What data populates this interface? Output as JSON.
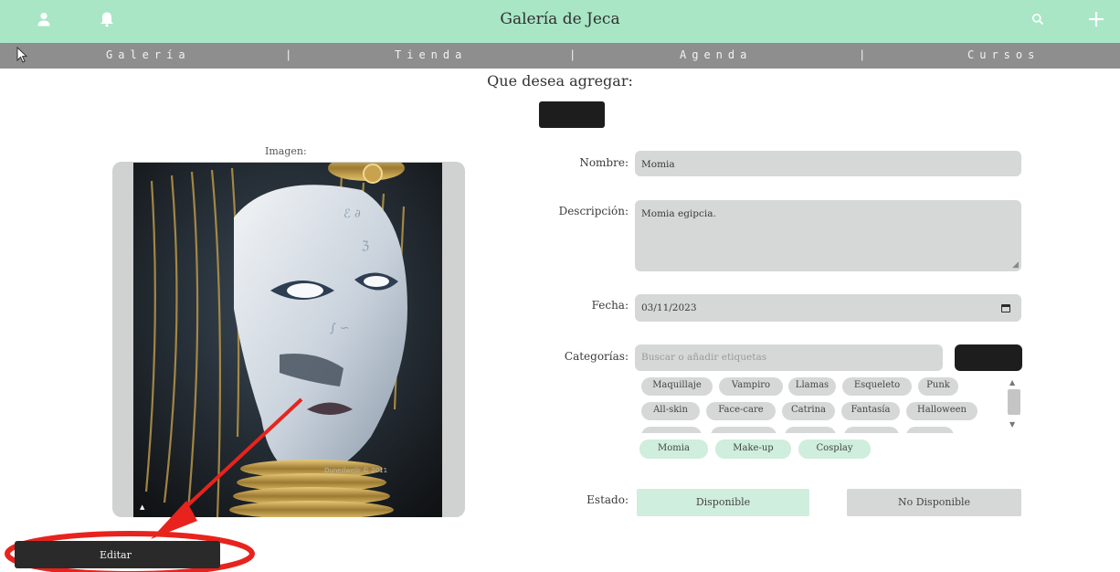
{
  "header": {
    "title": "Galería de Jeca",
    "colors": {
      "bar": "#a8e6c6",
      "nav": "#8e8e8e"
    }
  },
  "nav": {
    "items": [
      "Galería",
      "Tienda",
      "Agenda",
      "Cursos"
    ],
    "separator": "|"
  },
  "page": {
    "question": "Que desea agregar:"
  },
  "image_panel": {
    "label": "Imagen:",
    "photo_signature": "Dunedwellr © 2011",
    "photo_mark": "▲"
  },
  "form": {
    "name_label": "Nombre:",
    "name_value": "Momia",
    "description_label": "Descripción:",
    "description_value": "Momia egipcia.",
    "date_label": "Fecha:",
    "date_value": "03/11/2023",
    "categories_label": "Categorías:",
    "categories_placeholder": "Buscar o añadir etiquetas",
    "tag_chips": [
      "Maquillaje",
      "Vampiro",
      "Llamas",
      "Esqueleto",
      "Punk",
      "All-skin",
      "Face-care",
      "Catrina",
      "Fantasía",
      "Halloween"
    ],
    "selected_tags": [
      "Momia",
      "Make-up",
      "Cosplay"
    ],
    "state_label": "Estado:",
    "state_options": [
      "Disponible",
      "No Disponible"
    ],
    "state_selected": "Disponible"
  },
  "actions": {
    "edit_label": "Editar"
  },
  "colors": {
    "accent": "#a8e6c6",
    "selected_chip": "#cfeedd",
    "dark_button": "#1d1d1d",
    "field_bg": "#d6d8d7",
    "annotation": "#e8231d"
  }
}
